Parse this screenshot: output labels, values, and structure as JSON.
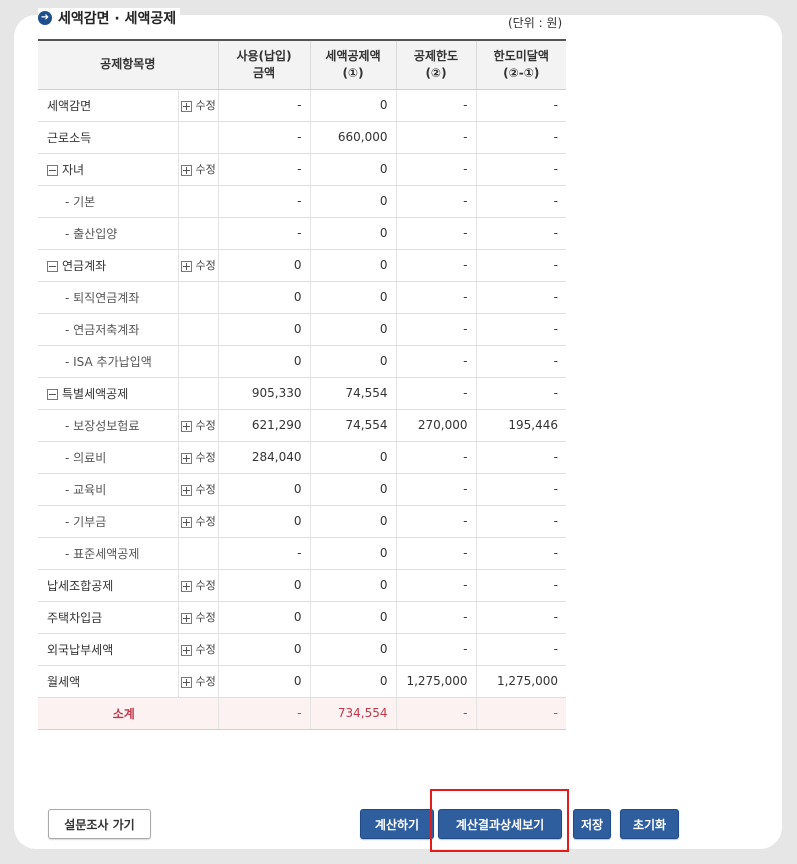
{
  "section": {
    "title": "세액감면 · 세액공제",
    "unit": "(단위 : 원)"
  },
  "table": {
    "headers": [
      {
        "line1": "공제항목명",
        "line2": ""
      },
      {
        "line1": "사용(납입)",
        "line2": "금액"
      },
      {
        "line1": "세액공제액",
        "line2": "(①)"
      },
      {
        "line1": "공제한도",
        "line2": "(②)"
      },
      {
        "line1": "한도미달액",
        "line2": "(②-①)"
      }
    ],
    "edit_label": "수정",
    "rows": [
      {
        "name": "세액감면",
        "edit": true,
        "amount": "-",
        "credit": "0",
        "limit": "-",
        "shortfall": "-"
      },
      {
        "name": "근로소득",
        "edit": false,
        "amount": "-",
        "credit": "660,000",
        "limit": "-",
        "shortfall": "-"
      },
      {
        "name": "자녀",
        "edit": true,
        "amount": "-",
        "credit": "0",
        "limit": "-",
        "shortfall": "-"
      },
      {
        "name": "- 기본",
        "edit": false,
        "amount": "-",
        "credit": "0",
        "limit": "-",
        "shortfall": "-"
      },
      {
        "name": "- 출산입양",
        "edit": false,
        "amount": "-",
        "credit": "0",
        "limit": "-",
        "shortfall": "-"
      },
      {
        "name": "연금계좌",
        "edit": true,
        "amount": "0",
        "credit": "0",
        "limit": "-",
        "shortfall": "-"
      },
      {
        "name": "- 퇴직연금계좌",
        "edit": false,
        "amount": "0",
        "credit": "0",
        "limit": "-",
        "shortfall": "-"
      },
      {
        "name": "- 연금저축계좌",
        "edit": false,
        "amount": "0",
        "credit": "0",
        "limit": "-",
        "shortfall": "-"
      },
      {
        "name": "- ISA 추가납입액",
        "edit": false,
        "amount": "0",
        "credit": "0",
        "limit": "-",
        "shortfall": "-"
      },
      {
        "name": "특별세액공제",
        "edit": false,
        "amount": "905,330",
        "credit": "74,554",
        "limit": "-",
        "shortfall": "-"
      },
      {
        "name": "- 보장성보험료",
        "edit": true,
        "amount": "621,290",
        "credit": "74,554",
        "limit": "270,000",
        "shortfall": "195,446"
      },
      {
        "name": "- 의료비",
        "edit": true,
        "amount": "284,040",
        "credit": "0",
        "limit": "-",
        "shortfall": "-"
      },
      {
        "name": "- 교육비",
        "edit": true,
        "amount": "0",
        "credit": "0",
        "limit": "-",
        "shortfall": "-"
      },
      {
        "name": "- 기부금",
        "edit": true,
        "amount": "0",
        "credit": "0",
        "limit": "-",
        "shortfall": "-"
      },
      {
        "name": "- 표준세액공제",
        "edit": false,
        "amount": "-",
        "credit": "0",
        "limit": "-",
        "shortfall": "-"
      },
      {
        "name": "납세조합공제",
        "edit": true,
        "amount": "0",
        "credit": "0",
        "limit": "-",
        "shortfall": "-"
      },
      {
        "name": "주택차입금",
        "edit": true,
        "amount": "0",
        "credit": "0",
        "limit": "-",
        "shortfall": "-"
      },
      {
        "name": "외국납부세액",
        "edit": true,
        "amount": "0",
        "credit": "0",
        "limit": "-",
        "shortfall": "-"
      },
      {
        "name": "월세액",
        "edit": true,
        "amount": "0",
        "credit": "0",
        "limit": "1,275,000",
        "shortfall": "1,275,000"
      }
    ],
    "total": {
      "name": "소계",
      "amount": "-",
      "credit": "734,554",
      "limit": "-",
      "shortfall": "-"
    }
  },
  "buttons": {
    "survey": "설문조사 가기",
    "calculate": "계산하기",
    "details": "계산결과상세보기",
    "save": "저장",
    "reset": "초기화"
  },
  "icons": {
    "title": "arrow-circle-icon",
    "expand": "expand-box-icon",
    "collapse": "collapse-box-icon"
  },
  "colors": {
    "header_border": "#555555",
    "button_blue": "#2f5e9e",
    "total_text": "#c0394b",
    "highlight": "#e41b1b"
  }
}
